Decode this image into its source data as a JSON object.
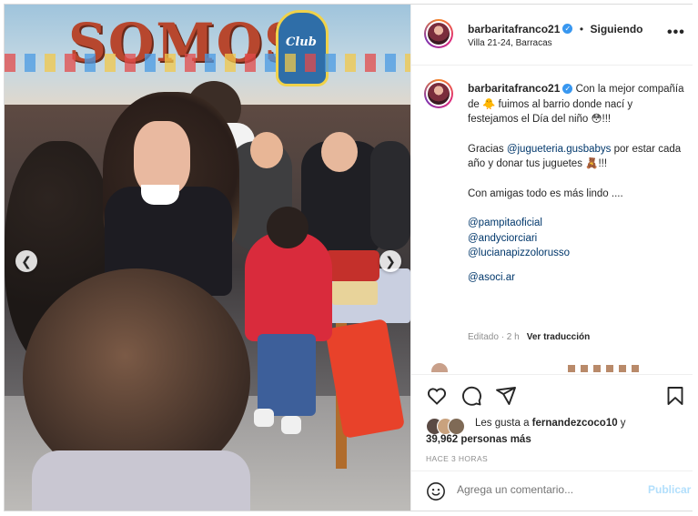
{
  "post": {
    "username": "barbaritafranco21",
    "follow_state": "Siguiendo",
    "separator": "•",
    "location": "Villa 21-24, Barracas",
    "more_icon": "more-dots-icon",
    "wall_text": "SOMOS",
    "club_text": "Club"
  },
  "caption": {
    "username": "barbaritafranco21",
    "line1": "Con la mejor compañía de 🐥 fuimos al barrio donde nací y festejamos el Día del niño 😳!!!",
    "line2_prefix": "Gracias ",
    "line2_link": "@jugueteria.gusbabys",
    "line2_suffix": " por estar cada año y donar tus juguetes 🧸!!!",
    "line3": "Con amigas todo es más lindo ....",
    "mentions": [
      "@pampitaoficial",
      "@andyciorciari",
      "@lucianapizzolorusso"
    ],
    "mention_last": "@asoci.ar",
    "edited": "Editado · 2 h",
    "translate": "Ver traducción"
  },
  "actions": {
    "like_icon": "heart-icon",
    "comment_icon": "comment-icon",
    "share_icon": "send-icon",
    "save_icon": "bookmark-icon"
  },
  "likes": {
    "prefix": "Les gusta a ",
    "user": "fernandezcoco10",
    "middle": " y",
    "count": "39,962 personas más",
    "time": "HACE 3 HORAS"
  },
  "comment": {
    "emoji_icon": "smiley-icon",
    "placeholder": "Agrega un comentario...",
    "publish": "Publicar"
  },
  "colors": {
    "link": "#00376b",
    "verified": "#3897f0",
    "publish_disabled": "#b2dffc",
    "muted": "#8e8e8e"
  }
}
